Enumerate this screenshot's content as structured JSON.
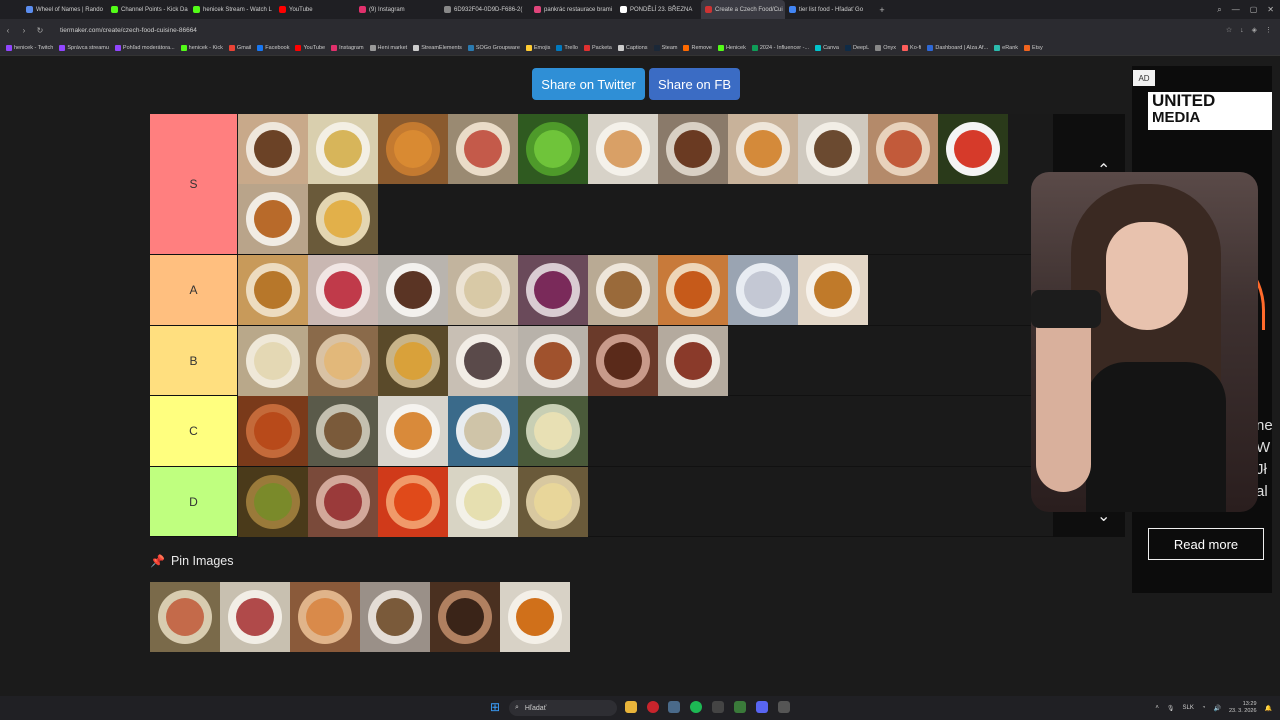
{
  "browser": {
    "tabs": [
      {
        "label": "Wheel of Names | Rando",
        "color": "#5b8def"
      },
      {
        "label": "Channel Points - Kick Da",
        "color": "#53fc18"
      },
      {
        "label": "henicek Stream - Watch L",
        "color": "#53fc18"
      },
      {
        "label": "YouTube",
        "color": "#ff0000"
      },
      {
        "label": "(9) Instagram",
        "color": "#e1306c"
      },
      {
        "label": "6D932F04-0D9D-F686-2(",
        "color": "#888888"
      },
      {
        "label": "pankrác restaurace brami",
        "color": "#e0457b"
      },
      {
        "label": "PONDĚLÍ 23. BŘEZNA",
        "color": "#ffffff"
      },
      {
        "label": "Create a Czech Food/Cui",
        "color": "#cc3333"
      },
      {
        "label": "tier list food - Hľadať Go",
        "color": "#4285f4"
      }
    ],
    "active_tab": 8,
    "new_tab": "+",
    "url": "tiermaker.com/create/czech-food-cuisine-86664",
    "bookmarks": [
      {
        "label": "henicek - Twitch",
        "color": "#9146ff"
      },
      {
        "label": "Správca streamu",
        "color": "#9146ff"
      },
      {
        "label": "Pohľad moderátora...",
        "color": "#9146ff"
      },
      {
        "label": "henicek - Kick",
        "color": "#53fc18"
      },
      {
        "label": "Gmail",
        "color": "#ea4335"
      },
      {
        "label": "Facebook",
        "color": "#1877f2"
      },
      {
        "label": "YouTube",
        "color": "#ff0000"
      },
      {
        "label": "Instagram",
        "color": "#e1306c"
      },
      {
        "label": "Heni market",
        "color": "#999999"
      },
      {
        "label": "StreamElements",
        "color": "#cccccc"
      },
      {
        "label": "SOGo Groupware",
        "color": "#2a7ab0"
      },
      {
        "label": "Emojis",
        "color": "#ffcc33"
      },
      {
        "label": "Trello",
        "color": "#0079bf"
      },
      {
        "label": "Packeta",
        "color": "#e03030"
      },
      {
        "label": "Captions",
        "color": "#cccccc"
      },
      {
        "label": "Steam",
        "color": "#1b2838"
      },
      {
        "label": "Remove",
        "color": "#ff6a00"
      },
      {
        "label": "Henicek",
        "color": "#53fc18"
      },
      {
        "label": "2024 - Influencer -...",
        "color": "#0f9d58"
      },
      {
        "label": "Canva",
        "color": "#00c4cc"
      },
      {
        "label": "DeepL",
        "color": "#0f2b46"
      },
      {
        "label": "Onyx",
        "color": "#888888"
      },
      {
        "label": "Ko-fi",
        "color": "#ff5e5b"
      },
      {
        "label": "Dashboard | Alza Af...",
        "color": "#2e68d6"
      },
      {
        "label": "eRank",
        "color": "#2bbbad"
      },
      {
        "label": "Etsy",
        "color": "#f1641e"
      }
    ]
  },
  "share": {
    "twitter": "Share on Twitter",
    "facebook": "Share on FB"
  },
  "tiers": [
    {
      "label": "S",
      "color": "#ff7f7f",
      "items": [
        {
          "name": "marble-cake",
          "bg": "#c8a98a",
          "plate": "#efe7dc",
          "food": "#6b4226"
        },
        {
          "name": "potato-soup",
          "bg": "#d9cfae",
          "plate": "#f3efe4",
          "food": "#d7b55a"
        },
        {
          "name": "fried-cheese-balls",
          "bg": "#8a5a2e",
          "plate": "#c47a30",
          "food": "#d98a32"
        },
        {
          "name": "open-sandwiches",
          "bg": "#9a8a72",
          "plate": "#eadcc8",
          "food": "#c45a4a"
        },
        {
          "name": "pea-puree",
          "bg": "#2f5a20",
          "plate": "#4e9a2a",
          "food": "#6fc43a"
        },
        {
          "name": "fish-potato-salad",
          "bg": "#d7d2c8",
          "plate": "#f4f1ea",
          "food": "#d9a066"
        },
        {
          "name": "meat-patties",
          "bg": "#8a7a6a",
          "plate": "#d9d0c4",
          "food": "#6a3a22"
        },
        {
          "name": "donuts",
          "bg": "#c8b29a",
          "plate": "#efe6da",
          "food": "#d48a3a"
        },
        {
          "name": "svickova-dumplings",
          "bg": "#cfc9bf",
          "plate": "#f2eee6",
          "food": "#6b4a30"
        },
        {
          "name": "topinka",
          "bg": "#b48a6a",
          "plate": "#e8d2bc",
          "food": "#c25a3a"
        },
        {
          "name": "tomato-soup",
          "bg": "#2a3a1a",
          "plate": "#f4f4f4",
          "food": "#d63a2a"
        },
        {
          "name": "schnitzel-potato-salad",
          "bg": "#b9a48a",
          "plate": "#f1ece4",
          "food": "#b86a2a"
        },
        {
          "name": "fish-fries",
          "bg": "#6a5a3a",
          "plate": "#e4d6b2",
          "food": "#e2b04a"
        }
      ]
    },
    {
      "label": "A",
      "color": "#ffbf7f",
      "items": [
        {
          "name": "potato-pancakes",
          "bg": "#c89a5a",
          "plate": "#eddcc0",
          "food": "#b7772a"
        },
        {
          "name": "kolache",
          "bg": "#c9b7b2",
          "plate": "#f1e6e4",
          "food": "#c03a4a"
        },
        {
          "name": "beef-dumplings-sauce",
          "bg": "#b9b4ae",
          "plate": "#f3f1ee",
          "food": "#5a3424"
        },
        {
          "name": "mushroom-soup",
          "bg": "#c2b49e",
          "plate": "#ece3d4",
          "food": "#d8c9a6"
        },
        {
          "name": "duck-red-cabbage",
          "bg": "#6a4a5a",
          "plate": "#d9ccd2",
          "food": "#7a2a5a"
        },
        {
          "name": "roast-dumplings",
          "bg": "#b9aa94",
          "plate": "#eee6da",
          "food": "#9a6a3a"
        },
        {
          "name": "pork-gravy-dumplings",
          "bg": "#c87a3a",
          "plate": "#eed6b8",
          "food": "#c65a1a"
        },
        {
          "name": "plum-dumplings",
          "bg": "#9aa4b2",
          "plate": "#e8ecf2",
          "food": "#c4c8d4"
        },
        {
          "name": "chicken-paprika",
          "bg": "#e2d6c6",
          "plate": "#f6f1ea",
          "food": "#c07a2a"
        }
      ]
    },
    {
      "label": "B",
      "color": "#ffdf7f",
      "items": [
        {
          "name": "fruit-dumplings-cream",
          "bg": "#b9a88a",
          "plate": "#efe8d8",
          "food": "#e4d8b4"
        },
        {
          "name": "buchty",
          "bg": "#8a6a4a",
          "plate": "#d9c2a4",
          "food": "#e2b87a"
        },
        {
          "name": "fried-tofu-salad",
          "bg": "#5a4a2a",
          "plate": "#c8b48a",
          "food": "#d9a13a"
        },
        {
          "name": "poppyseed-noodles",
          "bg": "#c8bfb4",
          "plate": "#f2ede6",
          "food": "#5a4a4a"
        },
        {
          "name": "sausages",
          "bg": "#b8b2aa",
          "plate": "#ece8e2",
          "food": "#a0522d"
        },
        {
          "name": "chocolate-cake",
          "bg": "#6a3a2a",
          "plate": "#c89a8a",
          "food": "#5a2a1a"
        },
        {
          "name": "beef-pickles",
          "bg": "#b4aa9e",
          "plate": "#efeae2",
          "food": "#8a3a2a"
        }
      ]
    },
    {
      "label": "C",
      "color": "#ffff7f",
      "items": [
        {
          "name": "goulash-soup",
          "bg": "#7a3a1a",
          "plate": "#c46a3a",
          "food": "#b84a1a"
        },
        {
          "name": "liver-dish",
          "bg": "#5a5a4a",
          "plate": "#c4c0b0",
          "food": "#7a5a3a"
        },
        {
          "name": "chicken-sauce",
          "bg": "#d8d4cc",
          "plate": "#f5f3ef",
          "food": "#d98a3a"
        },
        {
          "name": "cream-soup",
          "bg": "#3a6a8a",
          "plate": "#e8ecef",
          "food": "#cfc4a8"
        },
        {
          "name": "potato-cabbage-dish",
          "bg": "#4a5a3a",
          "plate": "#c8cfb4",
          "food": "#e8e0b4"
        }
      ]
    },
    {
      "label": "D",
      "color": "#bfff7f",
      "items": [
        {
          "name": "lentil-soup",
          "bg": "#4a3a1a",
          "plate": "#9a7a3a",
          "food": "#7a8a2a"
        },
        {
          "name": "sauerkraut-pork",
          "bg": "#7a4a3a",
          "plate": "#d2a89a",
          "food": "#9a3a3a"
        },
        {
          "name": "tomato-sauce-dish",
          "bg": "#d03a1a",
          "plate": "#f09a6a",
          "food": "#e04a1a"
        },
        {
          "name": "dill-sauce",
          "bg": "#d8d4c4",
          "plate": "#f3f1e8",
          "food": "#e6dfb0"
        },
        {
          "name": "cheese-pieces",
          "bg": "#6a5a3a",
          "plate": "#d8c8a0",
          "food": "#e8d69a"
        }
      ]
    }
  ],
  "pin": {
    "title": "Pin Images",
    "items": [
      {
        "name": "pickled-sausages",
        "bg": "#7a6a4a",
        "plate": "#d8ccb0",
        "food": "#c46a4a"
      },
      {
        "name": "beef-spinach",
        "bg": "#c8c0b0",
        "plate": "#f2eee6",
        "food": "#b04a4a"
      },
      {
        "name": "braided-bread",
        "bg": "#8a5a3a",
        "plate": "#e0b48a",
        "food": "#d98a4a"
      },
      {
        "name": "dumplings-gravy",
        "bg": "#9a9088",
        "plate": "#e4ddd6",
        "food": "#7a5a3a"
      },
      {
        "name": "poppy-strudel",
        "bg": "#4a3020",
        "plate": "#b08060",
        "food": "#3a2418"
      },
      {
        "name": "goulash-bowl",
        "bg": "#d8d2c6",
        "plate": "#f4f0e8",
        "food": "#d0701a"
      }
    ]
  },
  "ad": {
    "badge": "AD",
    "brand_line1": "UNITED",
    "brand_line2": "MEDIA",
    "side_text": "ne W Jł al",
    "cta": "Read more"
  },
  "taskbar": {
    "search_placeholder": "Hľadať",
    "lang": "SLK",
    "time": "13:29",
    "date": "23. 3. 2026"
  }
}
